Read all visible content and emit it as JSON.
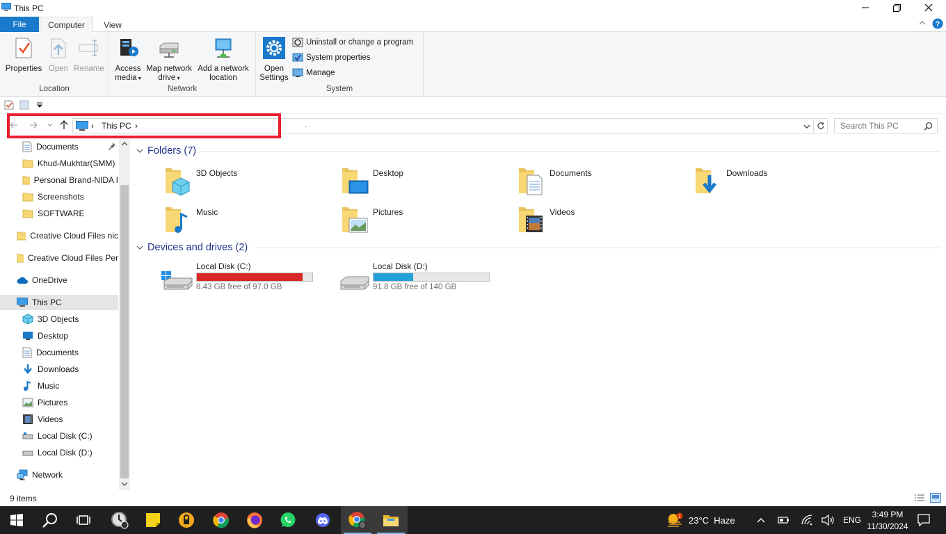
{
  "window": {
    "title": "This PC",
    "help": "?"
  },
  "tabs": {
    "file": "File",
    "computer": "Computer",
    "view": "View"
  },
  "ribbon": {
    "location": {
      "label": "Location",
      "properties": "Properties",
      "open": "Open",
      "rename": "Rename"
    },
    "network": {
      "label": "Network",
      "access_media_1": "Access",
      "access_media_2": "media",
      "map_drive_1": "Map network",
      "map_drive_2": "drive",
      "add_location_1": "Add a network",
      "add_location_2": "location"
    },
    "system": {
      "label": "System",
      "open_settings_1": "Open",
      "open_settings_2": "Settings",
      "uninstall": "Uninstall or change a program",
      "sys_props": "System properties",
      "manage": "Manage"
    }
  },
  "address": {
    "crumb": "This PC",
    "dot": "."
  },
  "search": {
    "placeholder": "Search This PC"
  },
  "nav": {
    "quick": [
      {
        "label": "Documents",
        "icon": "documents-icon",
        "pinned": true
      },
      {
        "label": "Khud-Mukhtar(SMM)",
        "icon": "folder-icon"
      },
      {
        "label": "Personal Brand-NIDA I",
        "icon": "folder-icon"
      },
      {
        "label": "Screenshots",
        "icon": "folder-icon"
      },
      {
        "label": "SOFTWARE",
        "icon": "folder-icon"
      }
    ],
    "cc1": "Creative Cloud Files  nic",
    "cc2": "Creative Cloud Files Per",
    "onedrive": "OneDrive",
    "thispc": "This PC",
    "pc_items": [
      {
        "label": "3D Objects",
        "icon": "3d-objects-icon"
      },
      {
        "label": "Desktop",
        "icon": "desktop-icon"
      },
      {
        "label": "Documents",
        "icon": "documents-icon"
      },
      {
        "label": "Downloads",
        "icon": "downloads-icon"
      },
      {
        "label": "Music",
        "icon": "music-icon"
      },
      {
        "label": "Pictures",
        "icon": "pictures-icon"
      },
      {
        "label": "Videos",
        "icon": "videos-icon"
      },
      {
        "label": "Local Disk (C:)",
        "icon": "drive-icon"
      },
      {
        "label": "Local Disk (D:)",
        "icon": "drive-icon"
      }
    ],
    "network": "Network"
  },
  "content": {
    "folders_header": "Folders (7)",
    "folders": [
      {
        "label": "3D Objects",
        "icon": "3d-objects-icon"
      },
      {
        "label": "Desktop",
        "icon": "desktop-icon"
      },
      {
        "label": "Documents",
        "icon": "documents-icon"
      },
      {
        "label": "Downloads",
        "icon": "downloads-icon"
      },
      {
        "label": "Music",
        "icon": "music-icon"
      },
      {
        "label": "Pictures",
        "icon": "pictures-icon"
      },
      {
        "label": "Videos",
        "icon": "videos-icon"
      }
    ],
    "drives_header": "Devices and drives (2)",
    "drives": [
      {
        "name": "Local Disk (C:)",
        "free": "8.43 GB free of 97.0 GB",
        "used_fraction": 0.913,
        "bar_color": "#da2626"
      },
      {
        "name": "Local Disk (D:)",
        "free": "91.8 GB free of 140 GB",
        "used_fraction": 0.344,
        "bar_color": "#26a0da"
      }
    ]
  },
  "status": {
    "items": "9 items"
  },
  "taskbar": {
    "weather": "23°C  Haze",
    "lang": "ENG",
    "time": "3:49 PM",
    "date": "11/30/2024",
    "weather_badge": "1"
  },
  "colors": {
    "accent": "#1979ca",
    "highlight": "#e8202f",
    "taskbar": "#1f1f1f"
  }
}
